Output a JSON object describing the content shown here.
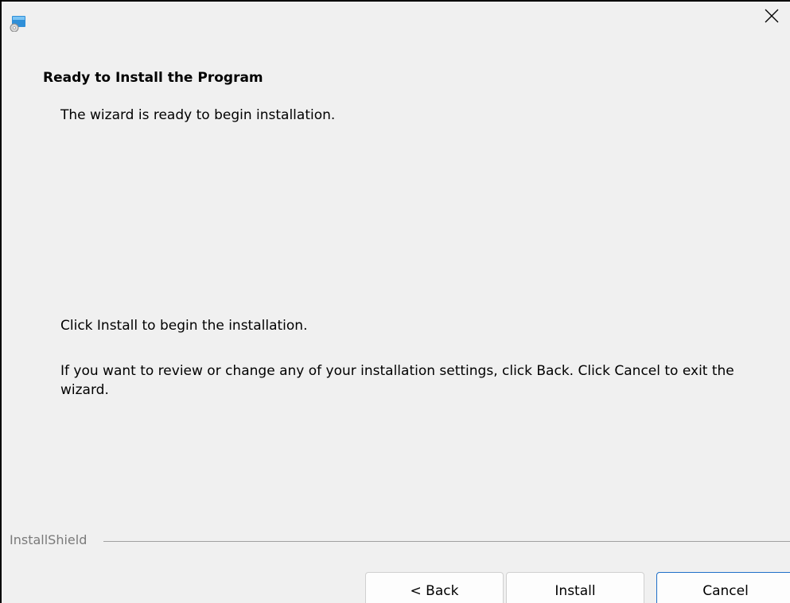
{
  "titlebar": {
    "icon": "installer-disc-icon",
    "close_icon": "close-icon"
  },
  "content": {
    "heading": "Ready to Install the Program",
    "subtitle": "The wizard is ready to begin installation.",
    "instruction": "Click Install to begin the installation.",
    "review_note": "If you want to review or change any of your installation settings, click Back. Click Cancel to exit the wizard."
  },
  "footer": {
    "brand": "InstallShield"
  },
  "buttons": {
    "back": "< Back",
    "install": "Install",
    "cancel": "Cancel"
  },
  "colors": {
    "background": "#f0f0f0",
    "focus_border": "#1f6fc8"
  }
}
